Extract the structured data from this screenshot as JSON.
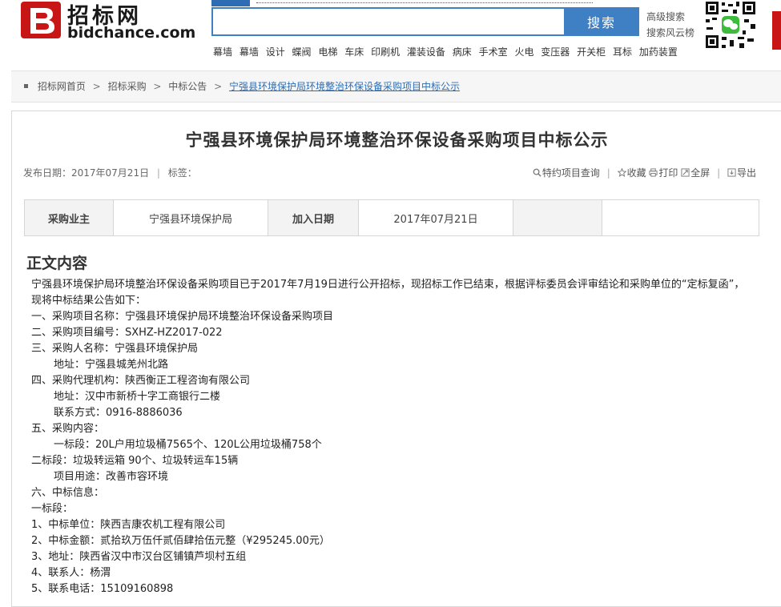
{
  "header": {
    "logo_cn": "招标网",
    "logo_en": "bidchance.com",
    "search_placeholder": "",
    "search_button": "搜索",
    "advanced_search": "高级搜索",
    "search_ranking": "搜索风云榜",
    "keywords": [
      "幕墙",
      "幕墙",
      "设计",
      "蝶阀",
      "电梯",
      "车床",
      "印刷机",
      "灌装设备",
      "病床",
      "手术室",
      "火电",
      "变压器",
      "开关柜",
      "耳标",
      "加药装置"
    ],
    "brand_color": "#c81616",
    "accent_color": "#3f80c4"
  },
  "breadcrumb": {
    "items": [
      "招标网首页",
      "招标采购",
      "中标公告"
    ],
    "current": "宁强县环境保护局环境整治环保设备采购项目中标公示",
    "separator": ">"
  },
  "article": {
    "title": "宁强县环境保护局环境整治环保设备采购项目中标公示",
    "publish_label": "发布日期：2017年07月21日",
    "tags_label": "标签：",
    "tools": {
      "query": "特约项目查询",
      "favorite": "收藏",
      "print": "打印",
      "fullscreen": "全屏",
      "export": "导出"
    },
    "info": {
      "owner_label": "采购业主",
      "owner_value": "宁强县环境保护局",
      "date_label": "加入日期",
      "date_value": "2017年07月21日"
    },
    "section_title": "正文内容",
    "lines": [
      "宁强县环境保护局环境整治环保设备采购项目已于2017年7月19日进行公开招标，现招标工作已结束，根据评标委员会评审结论和采购单位的“定标复函”，现将中标结果公告如下：",
      "一、采购项目名称：宁强县环境保护局环境整治环保设备采购项目",
      "二、采购项目编号：SXHZ-HZ2017-022",
      "三、采购人名称：宁强县环境保护局",
      "地址：宁强县城羌州北路",
      "四、采购代理机构：陕西衡正工程咨询有限公司",
      "地址：汉中市新桥十字工商银行二楼",
      "联系方式：0916-8886036",
      "五、采购内容：",
      "一标段：20L户用垃圾桶7565个、120L公用垃圾桶758个",
      "二标段：垃圾转运箱 90个、垃圾转运车15辆",
      "项目用途：改善市容环境",
      "六、中标信息：",
      "一标段：",
      "1、中标单位：陕西吉康农机工程有限公司",
      "2、中标金额：贰拾玖万伍仟贰佰肆拾伍元整（¥295245.00元）",
      "3、地址：陕西省汉中市汉台区铺镇芦坝村五组",
      "4、联系人：杨渭",
      "5、联系电话：15109160898"
    ]
  }
}
